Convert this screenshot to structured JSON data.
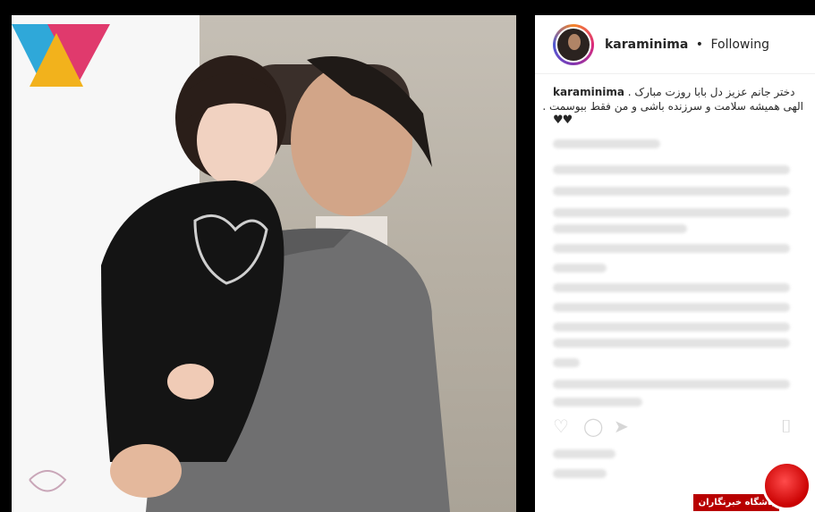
{
  "post": {
    "username": "karaminima",
    "separator": "•",
    "follow_status": "Following"
  },
  "caption": {
    "username": "karaminima",
    "line1": "دختر جانم عزیز دل بابا روزت مبارک .",
    "line2": "الهی همیشه سلامت و سرزنده باشی و من فقط ببوسمت .",
    "hearts": "♥♥"
  },
  "icons": {
    "like": "heart-icon",
    "comment": "comment-icon",
    "share": "share-icon",
    "save": "bookmark-icon"
  },
  "watermark": {
    "logo_glyph": "خ",
    "label": "باشگاه خبرنگاران"
  },
  "colors": {
    "username": "#262626",
    "watermark_red": "#c90000",
    "background": "#000000"
  }
}
